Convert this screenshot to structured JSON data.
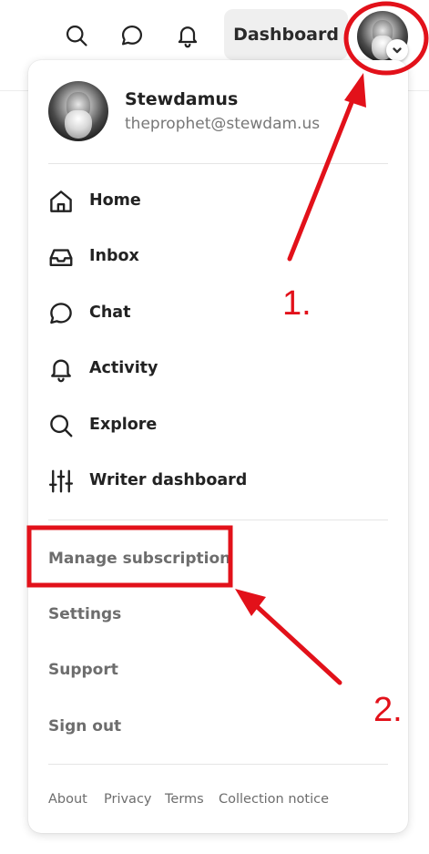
{
  "header": {
    "search_icon": "search-icon",
    "chat_icon": "chat-bubble-icon",
    "notifications_icon": "bell-icon",
    "dashboard_label": "Dashboard"
  },
  "profile": {
    "name": "Stewdamus",
    "email": "theprophet@stewdam.us"
  },
  "nav": {
    "items": [
      {
        "label": "Home",
        "icon": "home-icon"
      },
      {
        "label": "Inbox",
        "icon": "inbox-icon"
      },
      {
        "label": "Chat",
        "icon": "chat-bubble-icon"
      },
      {
        "label": "Activity",
        "icon": "bell-icon"
      },
      {
        "label": "Explore",
        "icon": "search-icon"
      },
      {
        "label": "Writer dashboard",
        "icon": "sliders-icon"
      }
    ]
  },
  "secondary": {
    "items": [
      {
        "label": "Manage subscription"
      },
      {
        "label": "Settings"
      },
      {
        "label": "Support"
      },
      {
        "label": "Sign out"
      }
    ]
  },
  "footer": {
    "links": [
      "About",
      "Privacy",
      "Terms",
      "Collection notice"
    ]
  },
  "annotations": {
    "step1": "1.",
    "step2": "2.",
    "color": "#e2111a"
  }
}
